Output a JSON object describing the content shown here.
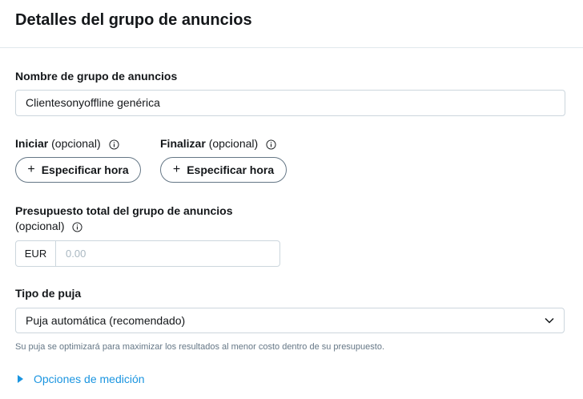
{
  "header": {
    "title": "Detalles del grupo de anuncios"
  },
  "name_field": {
    "label": "Nombre de grupo de anuncios",
    "value": "Clientesonyoffline genérica"
  },
  "start": {
    "label": "Iniciar",
    "optional": "(opcional)",
    "button_label": "Especificar hora"
  },
  "end": {
    "label": "Finalizar",
    "optional": "(opcional)",
    "button_label": "Especificar hora"
  },
  "budget": {
    "label": "Presupuesto total del grupo de anuncios",
    "optional": "(opcional)",
    "currency": "EUR",
    "placeholder": "0.00"
  },
  "bid": {
    "label": "Tipo de puja",
    "selected": "Puja automática (recomendado)",
    "hint": "Su puja se optimizará para maximizar los resultados al menor costo dentro de su presupuesto."
  },
  "measurement": {
    "label": "Opciones de medición"
  },
  "colors": {
    "accent": "#1b95e0",
    "text": "#14171a",
    "border": "#ccd6dd",
    "muted": "#657786"
  }
}
